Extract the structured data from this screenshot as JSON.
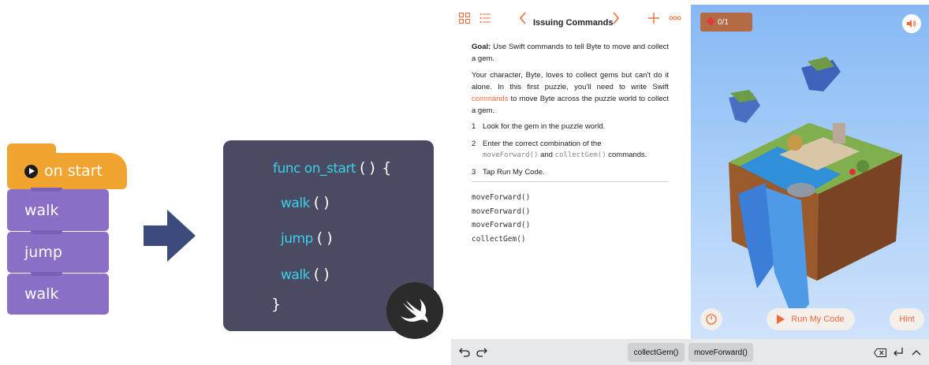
{
  "blocks": {
    "hat_label": "on start",
    "stack": [
      "walk",
      "jump",
      "walk"
    ]
  },
  "code": {
    "keyword": "func",
    "fn_name": "on_start",
    "fn_parens": "( )",
    "open_brace": "{",
    "close_brace": "}",
    "calls": [
      {
        "name": "walk",
        "parens": "( )"
      },
      {
        "name": "jump",
        "parens": "( )"
      },
      {
        "name": "walk",
        "parens": "( )"
      }
    ]
  },
  "playground": {
    "title": "Issuing Commands",
    "goal_label": "Goal:",
    "goal_text": "Use Swift commands to tell Byte to move and collect a gem.",
    "intro_before": "Your character, Byte, loves to collect gems but can't do it alone. In this first puzzle, you'll need to write Swift",
    "intro_link": "commands",
    "intro_after": "to move Byte across the puzzle world to collect a gem.",
    "steps": [
      {
        "num": "1",
        "text_a": "Look for the gem in the puzzle world.",
        "code_a": "",
        "text_b": "",
        "code_b": "",
        "text_c": ""
      },
      {
        "num": "2",
        "text_a": "Enter the correct combination of the",
        "code_a": "moveForward()",
        "text_b": "and",
        "code_b": "collectGem()",
        "text_c": "commands."
      },
      {
        "num": "3",
        "text_a": "Tap Run My Code.",
        "code_a": "",
        "text_b": "",
        "code_b": "",
        "text_c": ""
      }
    ],
    "code_lines": [
      "moveForward()",
      "moveForward()",
      "moveForward()",
      "collectGem()"
    ]
  },
  "game": {
    "gem_counter": "0/1",
    "run_button": "Run My Code",
    "hint_button": "Hint"
  },
  "bottombar": {
    "suggestions": [
      "collectGem()",
      "moveForward()"
    ]
  },
  "colors": {
    "accent": "#f26a3a",
    "block_purple": "#8a6fc6",
    "block_orange": "#f1a430",
    "code_bg": "#4a4a63",
    "code_cyan": "#3ad0e8"
  },
  "icons": [
    "grid-icon",
    "list-icon",
    "chevron-left-icon",
    "chevron-right-icon",
    "plus-icon",
    "more-icon",
    "speaker-icon",
    "speed-gauge-icon",
    "play-icon",
    "undo-icon",
    "redo-icon",
    "delete-icon",
    "return-icon",
    "chevron-up-icon",
    "swift-logo-icon"
  ]
}
